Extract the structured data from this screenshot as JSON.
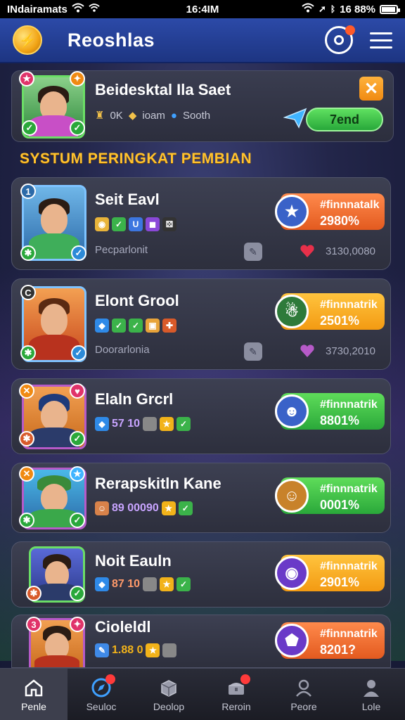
{
  "status_bar": {
    "carrier": "INdairamats",
    "time": "16:4IM",
    "battery": "16 88%"
  },
  "header": {
    "title": "Reoshlas"
  },
  "featured": {
    "name": "Beidesktal Ila Saet",
    "meta_1": "0K",
    "meta_2": "ioam",
    "meta_3": "Sooth",
    "close_label": "✕",
    "send_label": "7end"
  },
  "section_title": "SYSTUM PERINGKAT PEMBIAN",
  "rows": [
    {
      "name": "Seit Eavl",
      "sub": "Pecparlonit",
      "score": "3130,0080",
      "pill_title": "#finnnatalk",
      "pill_value": "2980%",
      "pill_color": "#e85f22"
    },
    {
      "name": "Elont Grool",
      "sub": "Doorarlonia",
      "score": "3730,2010",
      "pill_title": "#finnnatrik",
      "pill_value": "2501%",
      "pill_color": "#f39a12"
    },
    {
      "name": "Elaln Grcrl",
      "chip_text": "57 10",
      "pill_title": "#finnnatrik",
      "pill_value": "8801%",
      "pill_color": "#2aa83a"
    },
    {
      "name": "Rerapskitln Kane",
      "chip_text": "89 00090",
      "pill_title": "#finnnatrik",
      "pill_value": "0001%",
      "pill_color": "#2aa83a"
    },
    {
      "name": "Noit Eauln",
      "chip_text": "87 10",
      "pill_title": "#finnnatrik",
      "pill_value": "2901%",
      "pill_color": "#f39a12"
    },
    {
      "name": "Cioleldl",
      "chip_text": "1.88 0",
      "pill_title": "#finnnatrik",
      "pill_value": "8201?",
      "pill_color": "#e85f22"
    }
  ],
  "nav": [
    {
      "label": "Penle",
      "icon": "home-icon"
    },
    {
      "label": "Seuloc",
      "icon": "compass-icon"
    },
    {
      "label": "Deolop",
      "icon": "box-icon"
    },
    {
      "label": "Reroin",
      "icon": "chest-icon"
    },
    {
      "label": "Peore",
      "icon": "profile-icon"
    },
    {
      "label": "Lole",
      "icon": "user-icon"
    }
  ]
}
